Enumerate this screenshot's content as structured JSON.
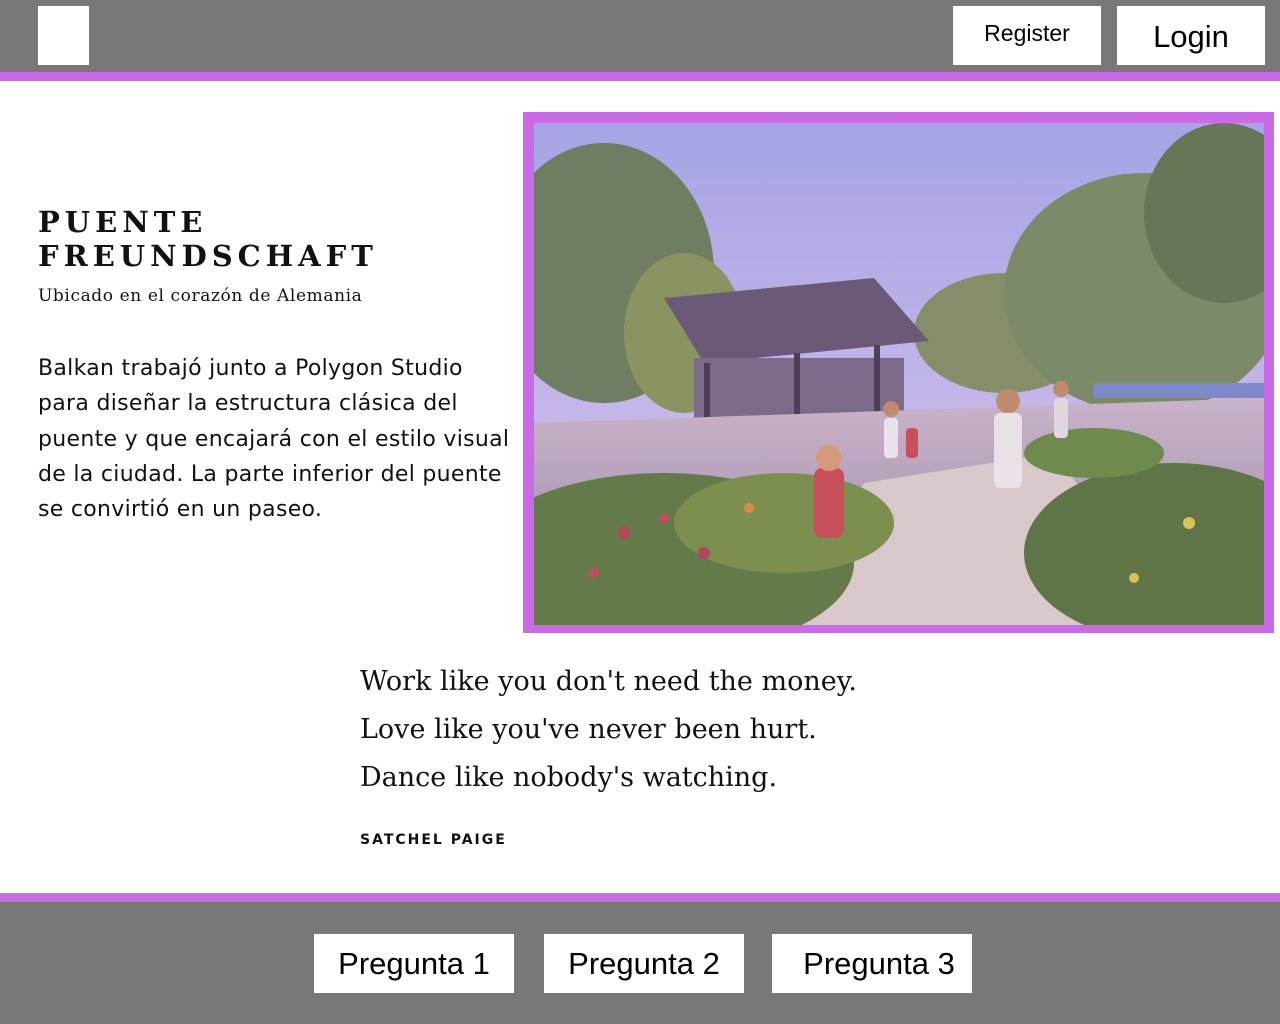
{
  "header": {
    "logo_icon": "logo-placeholder",
    "register_label": "Register",
    "login_label": "Login"
  },
  "hero": {
    "title": "Puente Freundschaft",
    "subtitle": "Ubicado en el corazón de Alemania",
    "body": "Balkan trabajó junto a Polygon Studio para diseñar la estructura clásica del puente y que encajará con el estilo visual de la ciudad. La parte inferior del puente se convirtió en un paseo."
  },
  "quote": {
    "lines": [
      "Work like you don't need the money.",
      "Love like you've never been hurt.",
      "Dance like nobody's watching."
    ],
    "author": "SATCHEL PAIGE"
  },
  "footer": {
    "buttons": [
      "Pregunta 1",
      "Pregunta 2",
      "Pregunta 3"
    ]
  },
  "colors": {
    "bar": "#787878",
    "accent": "#c96ae6",
    "button_bg": "#ffffff"
  }
}
